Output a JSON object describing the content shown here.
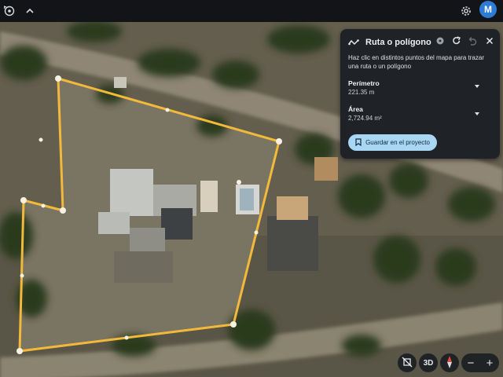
{
  "app": {
    "avatar_letter": "M",
    "icons": [
      "location-history-icon",
      "chevron-up-icon",
      "gear-icon"
    ]
  },
  "panel": {
    "title": "Ruta o polígono",
    "instructions": "Haz clic en distintos puntos del mapa para trazar una ruta o un polígono",
    "perimeter_label": "Perímetro",
    "perimeter_value": "221.35 m",
    "area_label": "Área",
    "area_value": "2,724.94 m²",
    "save_label": "Guardar en el proyecto",
    "header_icons": [
      "route-icon",
      "help-icon",
      "redo-icon",
      "undo-icon",
      "close-icon"
    ]
  },
  "map_controls": {
    "three_d_label": "3D",
    "zoom_out": "−",
    "zoom_in": "+",
    "icons": [
      "tilt-view-icon",
      "compass-icon"
    ]
  },
  "colors": {
    "polygon_outline": "#f2b93b",
    "panel_bg": "#1f2327",
    "button_bg": "#a9d6f2",
    "avatar_bg": "#2e7bd6"
  }
}
